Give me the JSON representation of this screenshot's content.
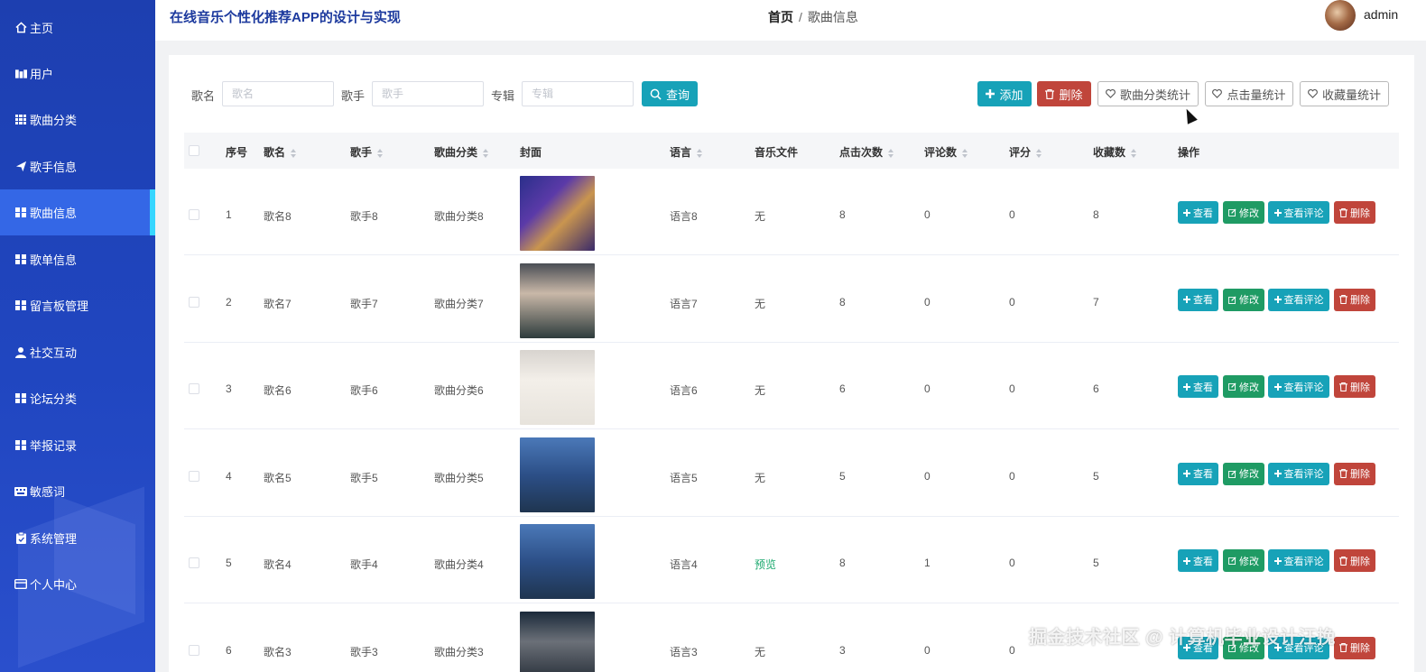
{
  "app": {
    "title": "在线音乐个性化推荐APP的设计与实现",
    "user": "admin",
    "breadcrumb": {
      "home": "首页",
      "separator": "/",
      "current": "歌曲信息"
    }
  },
  "sidebar": {
    "items": [
      {
        "label": "主页",
        "icon": "home-icon"
      },
      {
        "label": "用户",
        "icon": "users-icon"
      },
      {
        "label": "歌曲分类",
        "icon": "grid-icon"
      },
      {
        "label": "歌手信息",
        "icon": "paper-plane-icon"
      },
      {
        "label": "歌曲信息",
        "icon": "grid-icon",
        "active": true
      },
      {
        "label": "歌单信息",
        "icon": "grid-icon"
      },
      {
        "label": "留言板管理",
        "icon": "grid-icon"
      },
      {
        "label": "社交互动",
        "icon": "user-icon"
      },
      {
        "label": "论坛分类",
        "icon": "grid-icon"
      },
      {
        "label": "举报记录",
        "icon": "grid-icon"
      },
      {
        "label": "敏感词",
        "icon": "keyboard-icon"
      },
      {
        "label": "系统管理",
        "icon": "clipboard-icon"
      },
      {
        "label": "个人中心",
        "icon": "card-icon"
      }
    ]
  },
  "filters": {
    "song_label": "歌名",
    "song_placeholder": "歌名",
    "singer_label": "歌手",
    "singer_placeholder": "歌手",
    "album_label": "专辑",
    "album_placeholder": "专辑",
    "search_button": "查询"
  },
  "toolbar": {
    "add": "添加",
    "delete": "删除",
    "category_stats": "歌曲分类统计",
    "click_stats": "点击量统计",
    "favorite_stats": "收藏量统计"
  },
  "table": {
    "headers": {
      "index": "序号",
      "song": "歌名",
      "singer": "歌手",
      "category": "歌曲分类",
      "cover": "封面",
      "language": "语言",
      "music_file": "音乐文件",
      "clicks": "点击次数",
      "comments": "评论数",
      "rating": "评分",
      "favorites": "收藏数",
      "actions": "操作"
    },
    "actions": {
      "view": "查看",
      "edit": "修改",
      "view_comments": "查看评论",
      "delete": "删除"
    },
    "rows": [
      {
        "index": "1",
        "song": "歌名8",
        "singer": "歌手8",
        "category": "歌曲分类8",
        "language": "语言8",
        "file": "无",
        "clicks": "8",
        "comments": "0",
        "rating": "0",
        "favorites": "8"
      },
      {
        "index": "2",
        "song": "歌名7",
        "singer": "歌手7",
        "category": "歌曲分类7",
        "language": "语言7",
        "file": "无",
        "clicks": "8",
        "comments": "0",
        "rating": "0",
        "favorites": "7"
      },
      {
        "index": "3",
        "song": "歌名6",
        "singer": "歌手6",
        "category": "歌曲分类6",
        "language": "语言6",
        "file": "无",
        "clicks": "6",
        "comments": "0",
        "rating": "0",
        "favorites": "6"
      },
      {
        "index": "4",
        "song": "歌名5",
        "singer": "歌手5",
        "category": "歌曲分类5",
        "language": "语言5",
        "file": "无",
        "clicks": "5",
        "comments": "0",
        "rating": "0",
        "favorites": "5"
      },
      {
        "index": "5",
        "song": "歌名4",
        "singer": "歌手4",
        "category": "歌曲分类4",
        "language": "语言4",
        "file": "预览",
        "clicks": "8",
        "comments": "1",
        "rating": "0",
        "favorites": "5"
      },
      {
        "index": "6",
        "song": "歌名3",
        "singer": "歌手3",
        "category": "歌曲分类3",
        "language": "语言3",
        "file": "无",
        "clicks": "3",
        "comments": "0",
        "rating": "0",
        "favorites": ""
      }
    ]
  },
  "watermark": "掘金技术社区 @ 计算机毕业设计汪挽",
  "colors": {
    "sidebar": "#2046c0",
    "accent": "#17a2b8",
    "danger": "#c0453b",
    "success": "#1f9b64",
    "active_indicator": "#36d6ff"
  }
}
